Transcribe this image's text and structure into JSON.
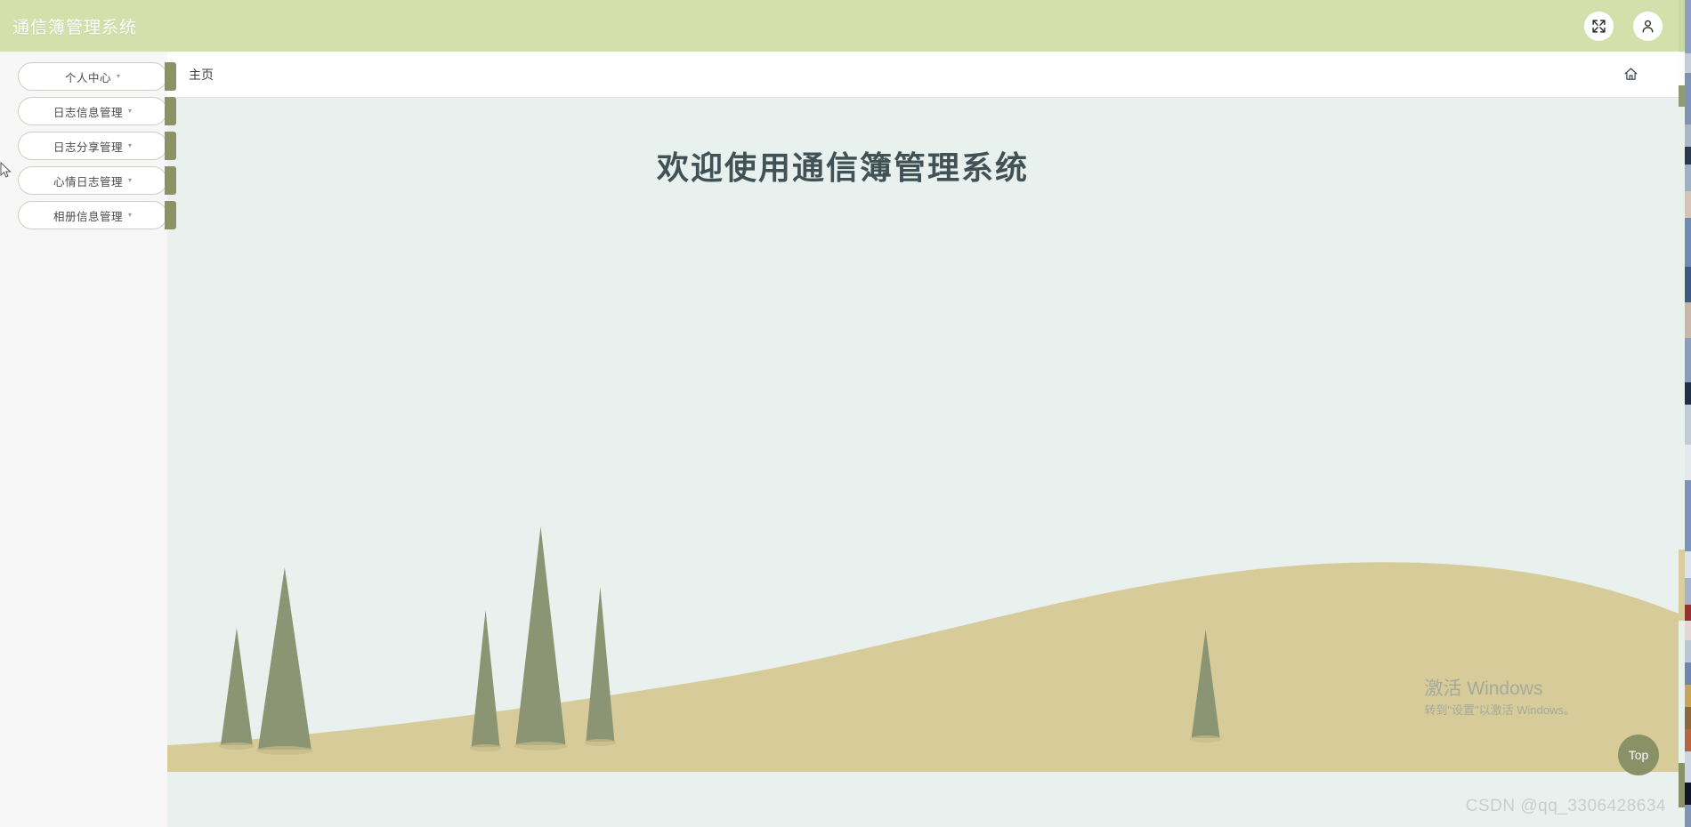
{
  "header": {
    "title": "通信簿管理系统",
    "fullscreen_icon": "fullscreen-expand-icon",
    "user_icon": "user-avatar-icon"
  },
  "sidebar": {
    "items": [
      {
        "label": "个人中心",
        "caret": "▾"
      },
      {
        "label": "日志信息管理",
        "caret": "▾"
      },
      {
        "label": "日志分享管理",
        "caret": "▾"
      },
      {
        "label": "心情日志管理",
        "caret": "▾"
      },
      {
        "label": "相册信息管理",
        "caret": "▾"
      }
    ]
  },
  "breadcrumb": {
    "current": "主页",
    "home_icon": "home-icon"
  },
  "main": {
    "welcome_title": "欢迎使用通信簿管理系统"
  },
  "back_to_top": {
    "label": "Top"
  },
  "watermarks": {
    "windows_activate_title": "激活 Windows",
    "windows_activate_sub": "转到\"设置\"以激活 Windows。",
    "csdn": "CSDN @qq_3306428634"
  },
  "colors": {
    "header_bg": "#d3e0ab",
    "sidebar_bg": "#f7f7f7",
    "content_bg": "#e8f1ed",
    "menu_tab": "#8c9166",
    "title_text": "#415257",
    "hill": "#d8cb9a",
    "tree": "#8b9573",
    "top_button": "#8a9167"
  }
}
